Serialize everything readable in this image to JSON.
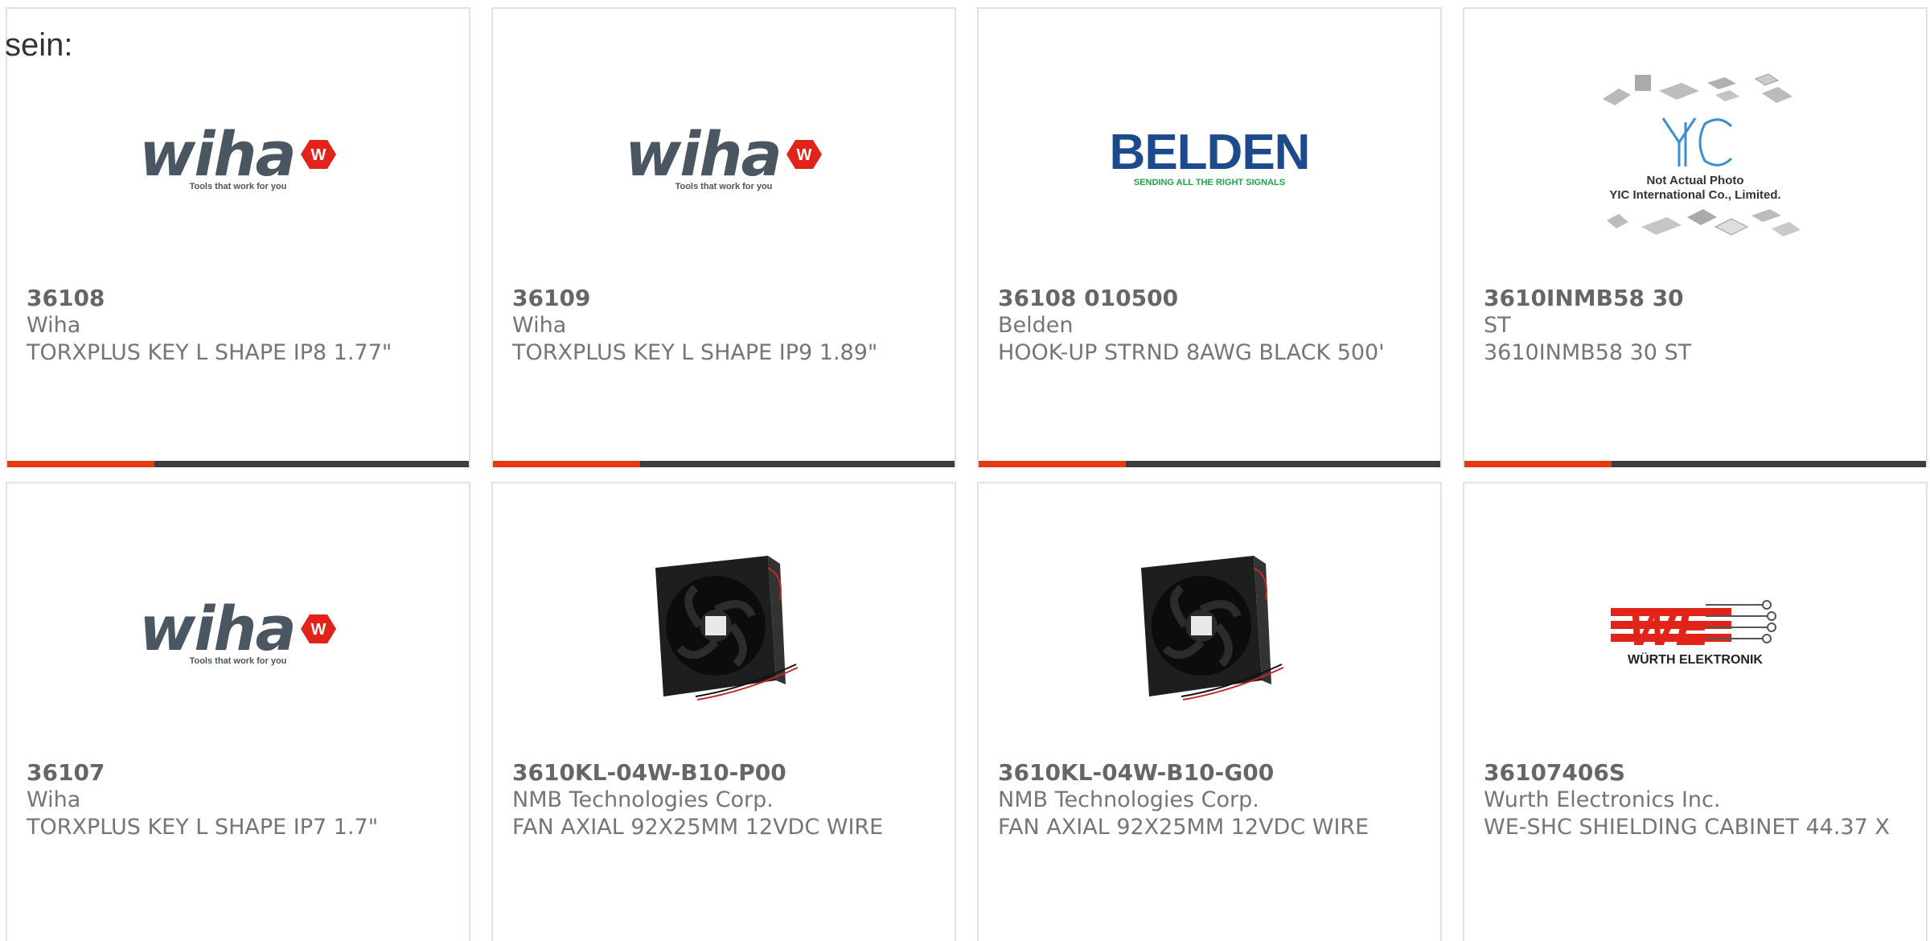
{
  "intro_text": "sein:",
  "accent_color": "#e8380d",
  "bar_color": "#3d3d3d",
  "products": [
    {
      "part_number": "36108",
      "manufacturer": "Wiha",
      "description": "TORXPLUS KEY L SHAPE IP8 1.77\"",
      "logo": {
        "name": "wiha",
        "word": "wiha",
        "tag": "Tools that work for you"
      }
    },
    {
      "part_number": "36109",
      "manufacturer": "Wiha",
      "description": "TORXPLUS KEY L SHAPE IP9 1.89\"",
      "logo": {
        "name": "wiha",
        "word": "wiha",
        "tag": "Tools that work for you"
      }
    },
    {
      "part_number": "36108 010500",
      "manufacturer": "Belden",
      "description": "HOOK-UP STRND 8AWG BLACK 500'",
      "logo": {
        "name": "belden",
        "word": "BELDEN",
        "tag": "SENDING ALL THE RIGHT SIGNALS"
      }
    },
    {
      "part_number": "3610INMB58 30",
      "manufacturer": "ST",
      "description": "3610INMB58 30 ST",
      "logo": {
        "name": "yic",
        "line1": "Not Actual Photo",
        "line2": "YIC International Co., Limited."
      }
    },
    {
      "part_number": "36107",
      "manufacturer": "Wiha",
      "description": "TORXPLUS KEY L SHAPE IP7 1.7\"",
      "logo": {
        "name": "wiha",
        "word": "wiha",
        "tag": "Tools that work for you"
      }
    },
    {
      "part_number": "3610KL-04W-B10-P00",
      "manufacturer": "NMB Technologies Corp.",
      "description": "FAN AXIAL 92X25MM 12VDC WIRE",
      "logo": {
        "name": "fan-photo"
      }
    },
    {
      "part_number": "3610KL-04W-B10-G00",
      "manufacturer": "NMB Technologies Corp.",
      "description": "FAN AXIAL 92X25MM 12VDC WIRE",
      "logo": {
        "name": "fan-photo"
      }
    },
    {
      "part_number": "36107406S",
      "manufacturer": "Wurth Electronics Inc.",
      "description": "WE-SHC SHIELDING CABINET 44.37 X",
      "logo": {
        "name": "wurth",
        "tag": "WÜRTH ELEKTRONIK"
      }
    }
  ]
}
